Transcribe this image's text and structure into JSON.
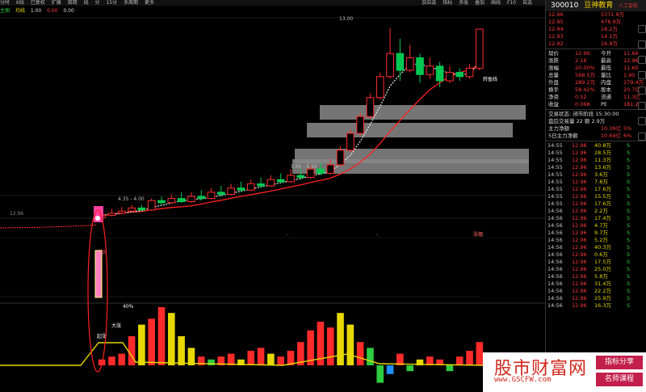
{
  "topbar": {
    "items": [
      "分时",
      "K线",
      "已复权",
      "扩展",
      "周期",
      "线",
      "分",
      "15分",
      "多周期",
      "更多"
    ],
    "right": [
      "加自选",
      "指标",
      "多股",
      "叠加",
      "画线",
      "F10",
      "自选"
    ]
  },
  "indicator_line": {
    "items": [
      "主图",
      "均线",
      "1.00",
      "0.00",
      "0.00"
    ]
  },
  "chart_labels": {
    "price_top": "13.00",
    "range1": "4.35 - 4.00",
    "range2": "5.90 - 6.50",
    "resistance": "转盈线",
    "axis": [
      "12.96",
      "11.93",
      "9.74%",
      "20.00%",
      "16%"
    ],
    "small": [
      "-",
      "-",
      "涨幅"
    ],
    "marker_text": "超买",
    "vol_labels": [
      "起涨",
      "大涨",
      "40%"
    ]
  },
  "chart_data": {
    "type": "candlestick",
    "candles": [
      {
        "o": 4.0,
        "c": 4.1,
        "h": 4.35,
        "l": 3.95
      },
      {
        "o": 4.1,
        "c": 4.2,
        "h": 4.4,
        "l": 4.05
      },
      {
        "o": 4.2,
        "c": 4.3,
        "h": 4.5,
        "l": 4.15
      },
      {
        "o": 4.3,
        "c": 4.45,
        "h": 4.6,
        "l": 4.25
      },
      {
        "o": 4.45,
        "c": 4.35,
        "h": 4.6,
        "l": 4.3
      },
      {
        "o": 4.35,
        "c": 4.8,
        "h": 4.9,
        "l": 4.3
      },
      {
        "o": 4.8,
        "c": 4.7,
        "h": 5.0,
        "l": 4.6
      },
      {
        "o": 4.7,
        "c": 4.9,
        "h": 5.1,
        "l": 4.65
      },
      {
        "o": 4.9,
        "c": 4.75,
        "h": 5.2,
        "l": 4.7
      },
      {
        "o": 4.75,
        "c": 5.0,
        "h": 5.2,
        "l": 4.7
      },
      {
        "o": 5.0,
        "c": 4.9,
        "h": 5.3,
        "l": 4.8
      },
      {
        "o": 4.9,
        "c": 5.2,
        "h": 5.4,
        "l": 4.85
      },
      {
        "o": 5.2,
        "c": 5.1,
        "h": 5.5,
        "l": 5.0
      },
      {
        "o": 5.1,
        "c": 5.4,
        "h": 5.6,
        "l": 5.05
      },
      {
        "o": 5.4,
        "c": 5.3,
        "h": 5.7,
        "l": 5.2
      },
      {
        "o": 5.3,
        "c": 5.6,
        "h": 5.8,
        "l": 5.25
      },
      {
        "o": 5.6,
        "c": 5.5,
        "h": 5.9,
        "l": 5.4
      },
      {
        "o": 5.5,
        "c": 5.8,
        "h": 6.0,
        "l": 5.45
      },
      {
        "o": 5.8,
        "c": 5.7,
        "h": 6.1,
        "l": 5.6
      },
      {
        "o": 5.7,
        "c": 6.0,
        "h": 6.3,
        "l": 5.65
      },
      {
        "o": 6.0,
        "c": 5.9,
        "h": 6.3,
        "l": 5.8
      },
      {
        "o": 5.9,
        "c": 6.3,
        "h": 6.5,
        "l": 5.85
      },
      {
        "o": 6.3,
        "c": 6.1,
        "h": 6.6,
        "l": 6.0
      },
      {
        "o": 6.1,
        "c": 6.5,
        "h": 6.8,
        "l": 6.05
      },
      {
        "o": 6.5,
        "c": 7.2,
        "h": 7.4,
        "l": 6.4
      },
      {
        "o": 7.2,
        "c": 8.0,
        "h": 8.2,
        "l": 7.1
      },
      {
        "o": 8.0,
        "c": 8.8,
        "h": 9.0,
        "l": 7.9
      },
      {
        "o": 8.8,
        "c": 9.7,
        "h": 9.9,
        "l": 8.7
      },
      {
        "o": 9.7,
        "c": 10.7,
        "h": 10.9,
        "l": 9.6
      },
      {
        "o": 10.7,
        "c": 11.8,
        "h": 13.0,
        "l": 10.6
      },
      {
        "o": 11.8,
        "c": 11.0,
        "h": 12.5,
        "l": 10.5
      },
      {
        "o": 11.0,
        "c": 11.6,
        "h": 12.2,
        "l": 10.9
      },
      {
        "o": 11.6,
        "c": 10.8,
        "h": 11.8,
        "l": 10.4
      },
      {
        "o": 10.8,
        "c": 11.2,
        "h": 11.6,
        "l": 10.6
      },
      {
        "o": 11.2,
        "c": 10.5,
        "h": 11.4,
        "l": 10.2
      },
      {
        "o": 10.5,
        "c": 10.9,
        "h": 11.2,
        "l": 10.4
      },
      {
        "o": 10.9,
        "c": 10.7,
        "h": 11.1,
        "l": 10.5
      },
      {
        "o": 10.7,
        "c": 11.1,
        "h": 11.3,
        "l": 10.6
      },
      {
        "o": 11.1,
        "c": 12.96,
        "h": 12.96,
        "l": 11.0
      }
    ],
    "volume": [
      {
        "v": 2,
        "c": "#ff2b2b"
      },
      {
        "v": 3,
        "c": "#ff2b2b"
      },
      {
        "v": 4,
        "c": "#ff2b2b"
      },
      {
        "v": 10,
        "c": "#ff2b2b"
      },
      {
        "v": 14,
        "c": "#e6d800"
      },
      {
        "v": 16,
        "c": "#ff2b2b"
      },
      {
        "v": 20,
        "c": "#ff2b2b"
      },
      {
        "v": 18,
        "c": "#e6d800"
      },
      {
        "v": 10,
        "c": "#e6d800"
      },
      {
        "v": 6,
        "c": "#e6d800"
      },
      {
        "v": 3,
        "c": "#ff2b2b"
      },
      {
        "v": 2,
        "c": "#2ecc40"
      },
      {
        "v": 3,
        "c": "#ff2b2b"
      },
      {
        "v": 4,
        "c": "#ff2b2b"
      },
      {
        "v": 2,
        "c": "#e6d800"
      },
      {
        "v": 5,
        "c": "#ff2b2b"
      },
      {
        "v": 6,
        "c": "#ff2b2b"
      },
      {
        "v": 4,
        "c": "#e6d800"
      },
      {
        "v": 3,
        "c": "#ff2b2b"
      },
      {
        "v": 5,
        "c": "#ff2b2b"
      },
      {
        "v": 8,
        "c": "#ff2b2b"
      },
      {
        "v": 12,
        "c": "#ff2b2b"
      },
      {
        "v": 15,
        "c": "#ff2b2b"
      },
      {
        "v": 13,
        "c": "#ff2b2b"
      },
      {
        "v": 18,
        "c": "#e6d800"
      },
      {
        "v": 14,
        "c": "#e6d800"
      },
      {
        "v": 8,
        "c": "#ff2b2b"
      },
      {
        "v": 6,
        "c": "#2ecc40"
      },
      {
        "v": -6,
        "c": "#2ecc40"
      },
      {
        "v": -3,
        "c": "#1e90ff"
      },
      {
        "v": 4,
        "c": "#ff2b2b"
      },
      {
        "v": -2,
        "c": "#2ecc40"
      },
      {
        "v": 2,
        "c": "#e6d800"
      },
      {
        "v": 3,
        "c": "#ff2b2b"
      },
      {
        "v": 2,
        "c": "#ff2b2b"
      },
      {
        "v": -2,
        "c": "#2ecc40"
      },
      {
        "v": 3,
        "c": "#ff2b2b"
      },
      {
        "v": 5,
        "c": "#ff2b2b"
      },
      {
        "v": 8,
        "c": "#ff2b2b"
      }
    ],
    "colors": {
      "up": "#ff2b2b",
      "down": "#00c853",
      "ma": "#ff2020",
      "ma2": "#e0e0e0",
      "signal": "#e6d800"
    }
  },
  "right_panel": {
    "code": "300010",
    "name": "豆神教育",
    "tag": "人工智能",
    "quotes": [
      {
        "label": "12.96",
        "price": "5371.8万",
        "cls": "red"
      },
      {
        "label": "12.95",
        "price": "478.9万",
        "cls": "red"
      },
      {
        "label": "12.94",
        "price": "18.2万",
        "cls": "red"
      },
      {
        "label": "12.93",
        "price": "14.1万",
        "cls": "red"
      },
      {
        "label": "12.92",
        "price": "16.8万",
        "cls": "red"
      }
    ],
    "stats": [
      {
        "a": "现价",
        "b": "12.96",
        "c": "今开",
        "d": "11.66"
      },
      {
        "a": "涨跌",
        "b": "2.16",
        "c": "最高",
        "d": "12.96"
      },
      {
        "a": "涨幅",
        "b": "20.00%",
        "c": "最低",
        "d": "11.60"
      },
      {
        "a": "总量",
        "b": "568.5万",
        "c": "量比",
        "d": "1.90"
      },
      {
        "a": "外盘",
        "b": "289.2万",
        "c": "内盘",
        "d": "279.4万"
      },
      {
        "a": "换手",
        "b": "58.42%",
        "c": "股本",
        "d": "20.7亿"
      },
      {
        "a": "净资",
        "b": "0.52",
        "c": "流通",
        "d": "11.3亿"
      },
      {
        "a": "收益",
        "b": "0.068",
        "c": "PE",
        "d": "181.2"
      }
    ],
    "status": "交易状态: 闭市阶段 15:30:00",
    "status2": "盘后交易量 22 额 2.9万",
    "flows": [
      {
        "a": "主力净额",
        "b": "10.39亿",
        "c": "5%"
      },
      {
        "a": "5日主力净额",
        "b": "10.69亿",
        "c": "6%"
      }
    ],
    "trades": [
      {
        "t": "14:55",
        "p": "12.96",
        "v": "40.8万",
        "s": "S"
      },
      {
        "t": "14:55",
        "p": "12.96",
        "v": "28.5万",
        "s": "S"
      },
      {
        "t": "14:55",
        "p": "12.96",
        "v": "11.3万",
        "s": "S"
      },
      {
        "t": "14:55",
        "p": "12.96",
        "v": "13.6万",
        "s": "S"
      },
      {
        "t": "14:55",
        "p": "12.96",
        "v": "3.6万",
        "s": "S"
      },
      {
        "t": "14:55",
        "p": "12.96",
        "v": "7.8万",
        "s": "S"
      },
      {
        "t": "14:55",
        "p": "12.96",
        "v": "17.6万",
        "s": "S"
      },
      {
        "t": "14:55",
        "p": "12.96",
        "v": "15.5万",
        "s": "S"
      },
      {
        "t": "14:55",
        "p": "12.96",
        "v": "17.6万",
        "s": "S"
      },
      {
        "t": "14:56",
        "p": "12.96",
        "v": "2.2万",
        "s": "S"
      },
      {
        "t": "14:56",
        "p": "12.96",
        "v": "17.4万",
        "s": "S"
      },
      {
        "t": "14:56",
        "p": "12.96",
        "v": "4.7万",
        "s": "S"
      },
      {
        "t": "14:56",
        "p": "12.96",
        "v": "9.7万",
        "s": "S"
      },
      {
        "t": "14:56",
        "p": "12.96",
        "v": "5.2万",
        "s": "S"
      },
      {
        "t": "14:56",
        "p": "12.96",
        "v": "40.3万",
        "s": "S"
      },
      {
        "t": "14:56",
        "p": "12.96",
        "v": "0.6万",
        "s": "S"
      },
      {
        "t": "14:56",
        "p": "12.96",
        "v": "17.5万",
        "s": "S"
      },
      {
        "t": "14:56",
        "p": "12.96",
        "v": "25.0万",
        "s": "S"
      },
      {
        "t": "14:56",
        "p": "12.96",
        "v": "5.8万",
        "s": "S"
      },
      {
        "t": "14:56",
        "p": "12.96",
        "v": "31.4万",
        "s": "S"
      },
      {
        "t": "14:56",
        "p": "12.96",
        "v": "22.2万",
        "s": "S"
      },
      {
        "t": "14:56",
        "p": "12.96",
        "v": "25.9万",
        "s": "S"
      },
      {
        "t": "14:56",
        "p": "12.96",
        "v": "16.3万",
        "s": "S"
      }
    ]
  },
  "watermark": {
    "title": "股市财富网",
    "url": "www.GSCFW.com",
    "badge1": "指标分享",
    "badge2": "名师课程"
  }
}
